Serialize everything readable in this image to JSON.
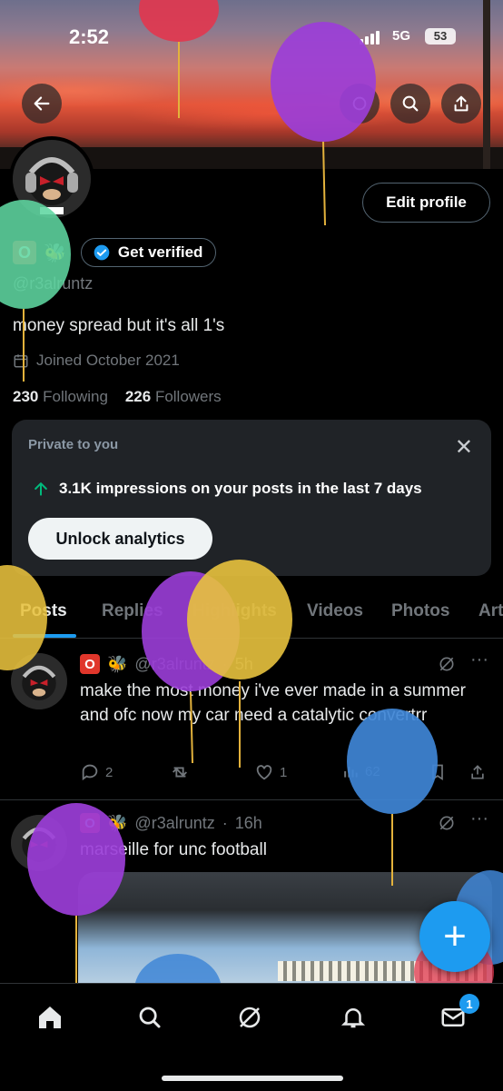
{
  "status": {
    "time": "2:52",
    "network": "5G",
    "battery": "53"
  },
  "profile": {
    "edit_label": "Edit profile",
    "name_emoji": "O",
    "verify_label": "Get verified",
    "handle": "@r3alruntz",
    "bio": "money spread but it's all 1's",
    "joined": "Joined October 2021",
    "following_count": "230",
    "following_label": "Following",
    "followers_count": "226",
    "followers_label": "Followers"
  },
  "private_card": {
    "title": "Private to you",
    "impressions": "3.1K impressions on your posts in the last 7 days",
    "unlock_label": "Unlock analytics"
  },
  "tabs": [
    "Posts",
    "Replies",
    "Highlights",
    "Videos",
    "Photos",
    "Art"
  ],
  "posts": [
    {
      "handle": "@r3alruntz",
      "time": "5h",
      "text": "make the most money i've ever made in a summer and ofc now my car need a catalytic convertrr",
      "replies": "2",
      "retweets": "",
      "likes": "1",
      "views": "62"
    },
    {
      "handle": "@r3alruntz",
      "time": "16h",
      "text": "marseille for unc football"
    }
  ],
  "nav": {
    "notifications_badge": "1"
  },
  "colors": {
    "accent": "#1d9bf0",
    "background": "#000000"
  }
}
